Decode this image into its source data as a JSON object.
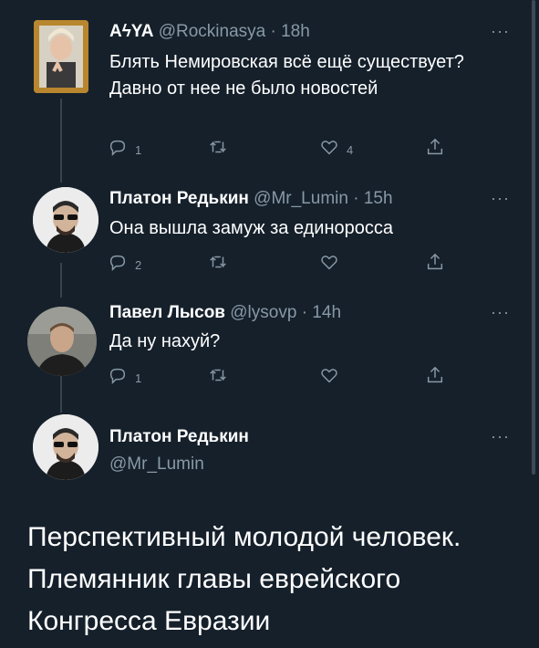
{
  "tweets": [
    {
      "name": "AϟYA",
      "handle": "@Rockinasya",
      "time": "· 18h",
      "text": "Блять Немировская всё ещё существует? Давно от нее не было новостей",
      "reply_count": "1",
      "retweet_count": "",
      "like_count": "4"
    },
    {
      "name": "Платон Редькин",
      "handle": "@Mr_Lumin",
      "time": "· 15h",
      "text": "Она вышла замуж за единоросса",
      "reply_count": "2",
      "retweet_count": "",
      "like_count": ""
    },
    {
      "name": "Павел Лысов",
      "handle": "@lysovp",
      "time": "· 14h",
      "text": "Да ну нахуй?",
      "reply_count": "1",
      "retweet_count": "",
      "like_count": ""
    }
  ],
  "main_tweet": {
    "name": "Платон Редькин",
    "handle": "@Mr_Lumin",
    "text": "Перспективный молодой человек. Племянник главы еврейского Конгресса Евразии"
  },
  "more_label": "···",
  "icons": {
    "reply": "reply-icon",
    "retweet": "retweet-icon",
    "like": "heart-icon",
    "share": "share-icon"
  },
  "colors": {
    "background": "#15202b",
    "muted": "#8899a6",
    "line": "#38444d"
  }
}
